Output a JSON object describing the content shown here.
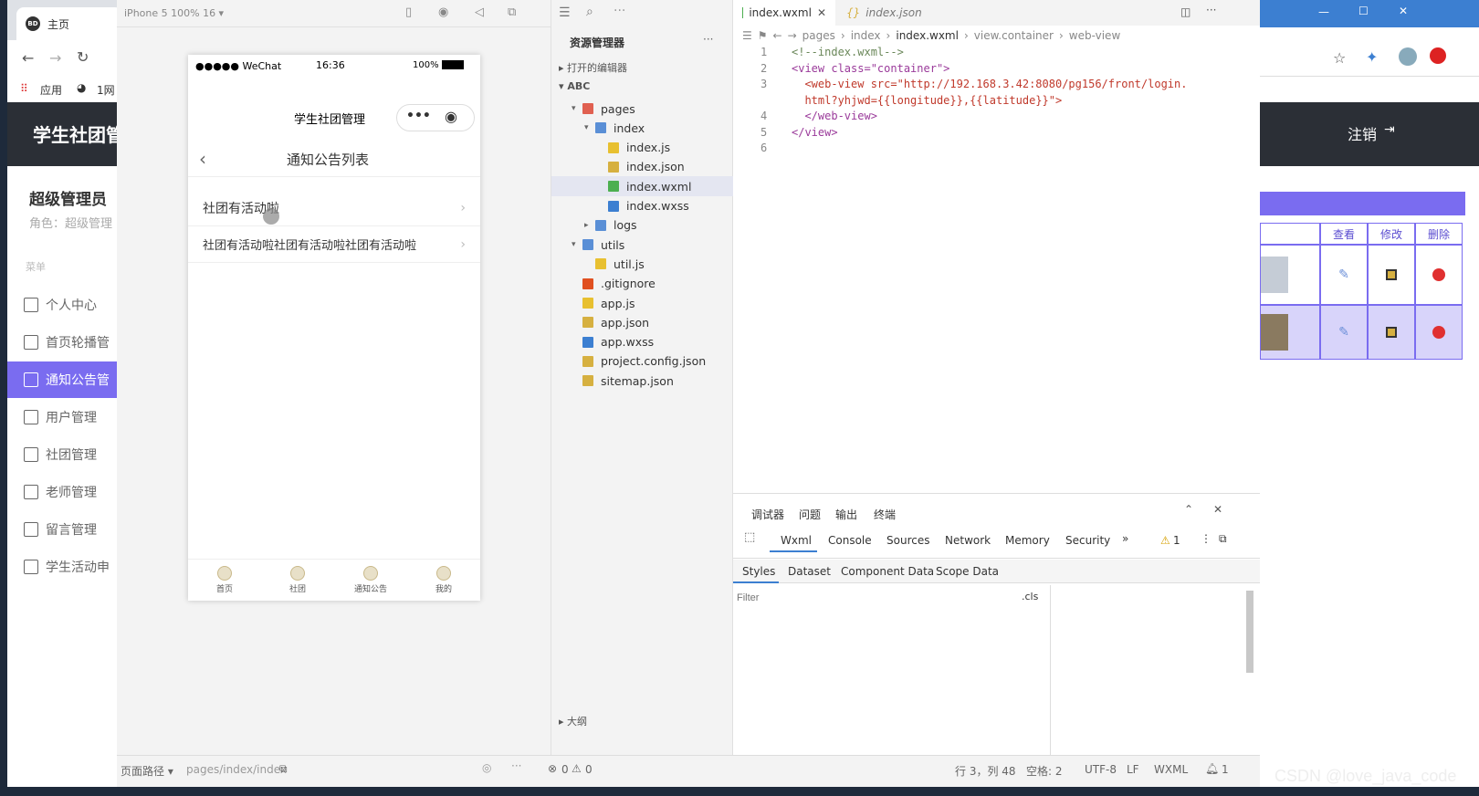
{
  "browser": {
    "tab_title": "主页",
    "bookmark_apps": "应用",
    "bookmark_other": "1网"
  },
  "admin": {
    "title": "学生社团管",
    "logout": "注销",
    "role_title": "超级管理员",
    "role_sub": "角色：超级管理",
    "menu_header": "菜单",
    "menu": [
      "个人中心",
      "首页轮播管",
      "通知公告管",
      "用户管理",
      "社团管理",
      "老师管理",
      "留言管理",
      "学生活动申"
    ],
    "table_headers": [
      "查看",
      "修改",
      "删除"
    ]
  },
  "simulator": {
    "device": "iPhone 5 100% 16 ▾",
    "carrier": "●●●●● WeChat",
    "time": "16:36",
    "battery": "100%",
    "app_title": "学生社团管理",
    "page_title": "通知公告列表",
    "list": [
      "社团有活动啦",
      "社团有活动啦社团有活动啦社团有活动啦"
    ],
    "tabs": [
      "首页",
      "社团",
      "通知公告",
      "我的"
    ]
  },
  "explorer": {
    "title": "资源管理器",
    "open_editors": "打开的编辑器",
    "project": "ABC",
    "tree": [
      {
        "label": "pages",
        "depth": 1,
        "type": "folder-red",
        "arrow": "▾"
      },
      {
        "label": "index",
        "depth": 2,
        "type": "folder",
        "arrow": "▾"
      },
      {
        "label": "index.js",
        "depth": 3,
        "type": "js"
      },
      {
        "label": "index.json",
        "depth": 3,
        "type": "json"
      },
      {
        "label": "index.wxml",
        "depth": 3,
        "type": "wxml",
        "selected": true
      },
      {
        "label": "index.wxss",
        "depth": 3,
        "type": "wxss"
      },
      {
        "label": "logs",
        "depth": 2,
        "type": "folder",
        "arrow": "▸"
      },
      {
        "label": "utils",
        "depth": 1,
        "type": "folder",
        "arrow": "▾"
      },
      {
        "label": "util.js",
        "depth": 2,
        "type": "js"
      },
      {
        "label": ".gitignore",
        "depth": 1,
        "type": "git"
      },
      {
        "label": "app.js",
        "depth": 1,
        "type": "js"
      },
      {
        "label": "app.json",
        "depth": 1,
        "type": "json"
      },
      {
        "label": "app.wxss",
        "depth": 1,
        "type": "wxss"
      },
      {
        "label": "project.config.json",
        "depth": 1,
        "type": "json"
      },
      {
        "label": "sitemap.json",
        "depth": 1,
        "type": "json"
      }
    ],
    "outline": "大纲"
  },
  "editor": {
    "tab_active": "index.wxml",
    "tab_other": "index.json",
    "crumbs": [
      "pages",
      "index",
      "index.wxml",
      "view.container",
      "web-view"
    ],
    "lines": [
      "<!--index.wxml-->",
      "<view class=\"container\">",
      "  <web-view src=\"http://192.168.3.42:8080/pg156/front/login.",
      "  html?yhjwd={{longitude}},{{latitude}}\">",
      "  </web-view>",
      "</view>",
      ""
    ],
    "line_numbers": [
      "1",
      "2",
      "3",
      "",
      "4",
      "5",
      "6"
    ]
  },
  "debugger": {
    "top_tabs": [
      "调试器",
      "问题",
      "输出",
      "终端"
    ],
    "tabs": [
      "Wxml",
      "Console",
      "Sources",
      "Network",
      "Memory",
      "Security"
    ],
    "warn_count": "1",
    "sub_tabs": [
      "Styles",
      "Dataset",
      "Component Data",
      "Scope Data"
    ],
    "filter_placeholder": "Filter",
    "cls": ".cls"
  },
  "statusline": {
    "path_label": "页面路径 ▾",
    "path": "pages/index/index",
    "errors": "0",
    "warnings": "0",
    "position": "行 3，列 48",
    "spaces": "空格: 2",
    "encoding": "UTF-8",
    "eol": "LF",
    "lang": "WXML",
    "notify": "1"
  },
  "watermark": "CSDN @love_java_code",
  "colors": {
    "accent": "#7a6cf0",
    "dark_header": "#2b2f36"
  }
}
